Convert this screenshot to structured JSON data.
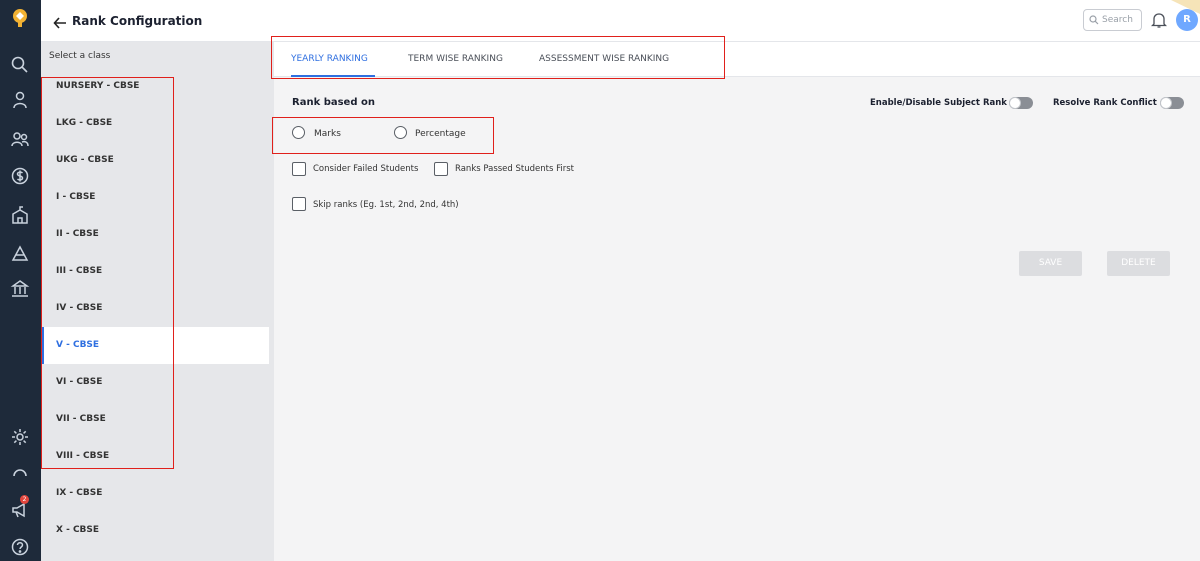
{
  "header": {
    "title": "Rank Configuration",
    "search_placeholder": "Search",
    "avatar_initial": "R"
  },
  "rail": {
    "icons": [
      "logo-icon",
      "search-icon",
      "student-icon",
      "users-icon",
      "fees-icon",
      "building-icon",
      "inventory-icon",
      "transport-icon",
      "settings-icon",
      "support-icon",
      "announcement-icon",
      "help-icon"
    ],
    "notification_count": "2"
  },
  "classes": {
    "label": "Select a class",
    "items": [
      {
        "label": "NURSERY - CBSE"
      },
      {
        "label": "LKG - CBSE"
      },
      {
        "label": "UKG - CBSE"
      },
      {
        "label": "I - CBSE"
      },
      {
        "label": "II - CBSE"
      },
      {
        "label": "III - CBSE"
      },
      {
        "label": "IV - CBSE"
      },
      {
        "label": "V - CBSE"
      },
      {
        "label": "VI - CBSE"
      },
      {
        "label": "VII - CBSE"
      },
      {
        "label": "VIII - CBSE"
      },
      {
        "label": "IX - CBSE"
      },
      {
        "label": "X - CBSE"
      }
    ],
    "selected": "V - CBSE"
  },
  "tabs": [
    {
      "label": "YEARLY RANKING",
      "active": true
    },
    {
      "label": "TERM WISE RANKING",
      "active": false
    },
    {
      "label": "ASSESSMENT WISE RANKING",
      "active": false
    }
  ],
  "form": {
    "rank_based_on": "Rank based on",
    "options": [
      "Marks",
      "Percentage"
    ],
    "enable_subject_rank": "Enable/Disable Subject Rank",
    "resolve_conflict": "Resolve Rank Conflict",
    "consider_failed": "Consider Failed Students",
    "ranks_passed_first": "Ranks Passed Students First",
    "skip_ranks": "Skip ranks (Eg. 1st, 2nd, 2nd, 4th)",
    "save": "SAVE",
    "delete": "DELETE"
  },
  "colors": {
    "accent": "#2f6fe0",
    "rail": "#1e2a3a",
    "highlight": "#e0201b"
  }
}
